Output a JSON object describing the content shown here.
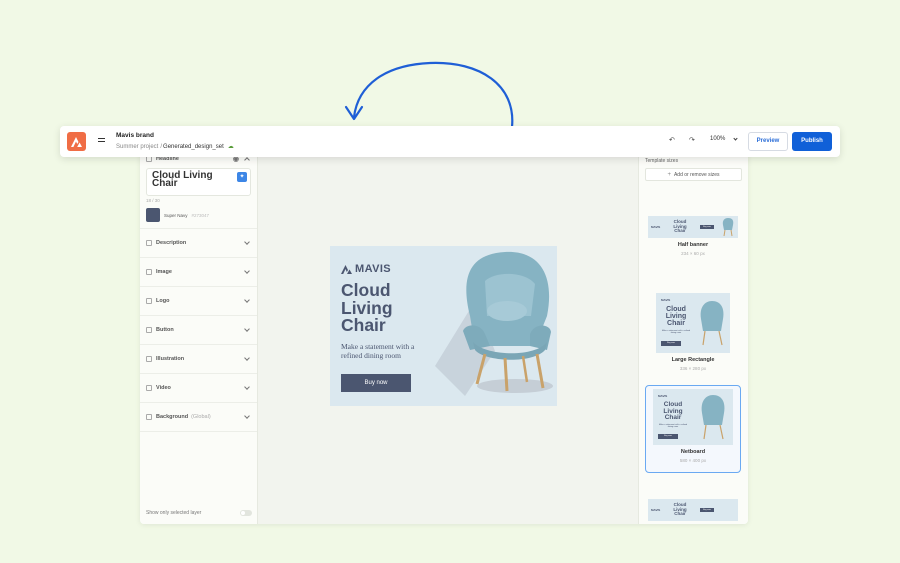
{
  "topbar": {
    "brand": "Mavis brand",
    "project": "Summer project",
    "separator": "/",
    "file": "Generated_design_set",
    "zoom": "100%",
    "preview": "Preview",
    "publish": "Publish",
    "icons": [
      "app-logo",
      "menu-icon",
      "cloud-saved-icon",
      "undo-icon",
      "redo-icon",
      "chevron-down-icon"
    ]
  },
  "left_panel": {
    "headline_label": "Headline",
    "headline_value": "Cloud Living Chair",
    "char_count": "18 / 30",
    "color_name": "Super Navy",
    "color_hex": "#273047",
    "sections": [
      {
        "label": "Description",
        "extra": ""
      },
      {
        "label": "Image",
        "extra": ""
      },
      {
        "label": "Logo",
        "extra": ""
      },
      {
        "label": "Button",
        "extra": ""
      },
      {
        "label": "Illustration",
        "extra": ""
      },
      {
        "label": "Video",
        "extra": ""
      },
      {
        "label": "Background",
        "extra": "(Global)"
      }
    ],
    "toggle_label": "Show only selected layer"
  },
  "banner": {
    "logo": "MAVIS",
    "title": "Cloud Living Chair",
    "description": "Make a statement with a refined dining room",
    "button": "Buy now"
  },
  "right_panel": {
    "title": "Template sizes",
    "add_label": "Add or remove sizes",
    "templates": [
      {
        "name": "Half banner",
        "size": "234 × 60 px",
        "selected": false
      },
      {
        "name": "Large Rectangle",
        "size": "336 × 280 px",
        "selected": false
      },
      {
        "name": "Netboard",
        "size": "580 × 400 px",
        "selected": true
      }
    ]
  },
  "colors": {
    "accent": "#1060d8",
    "brand_logo": "#f06d45",
    "navy": "#4b5670",
    "background": "#f1f9e6",
    "arrow": "#1f5fd6"
  }
}
